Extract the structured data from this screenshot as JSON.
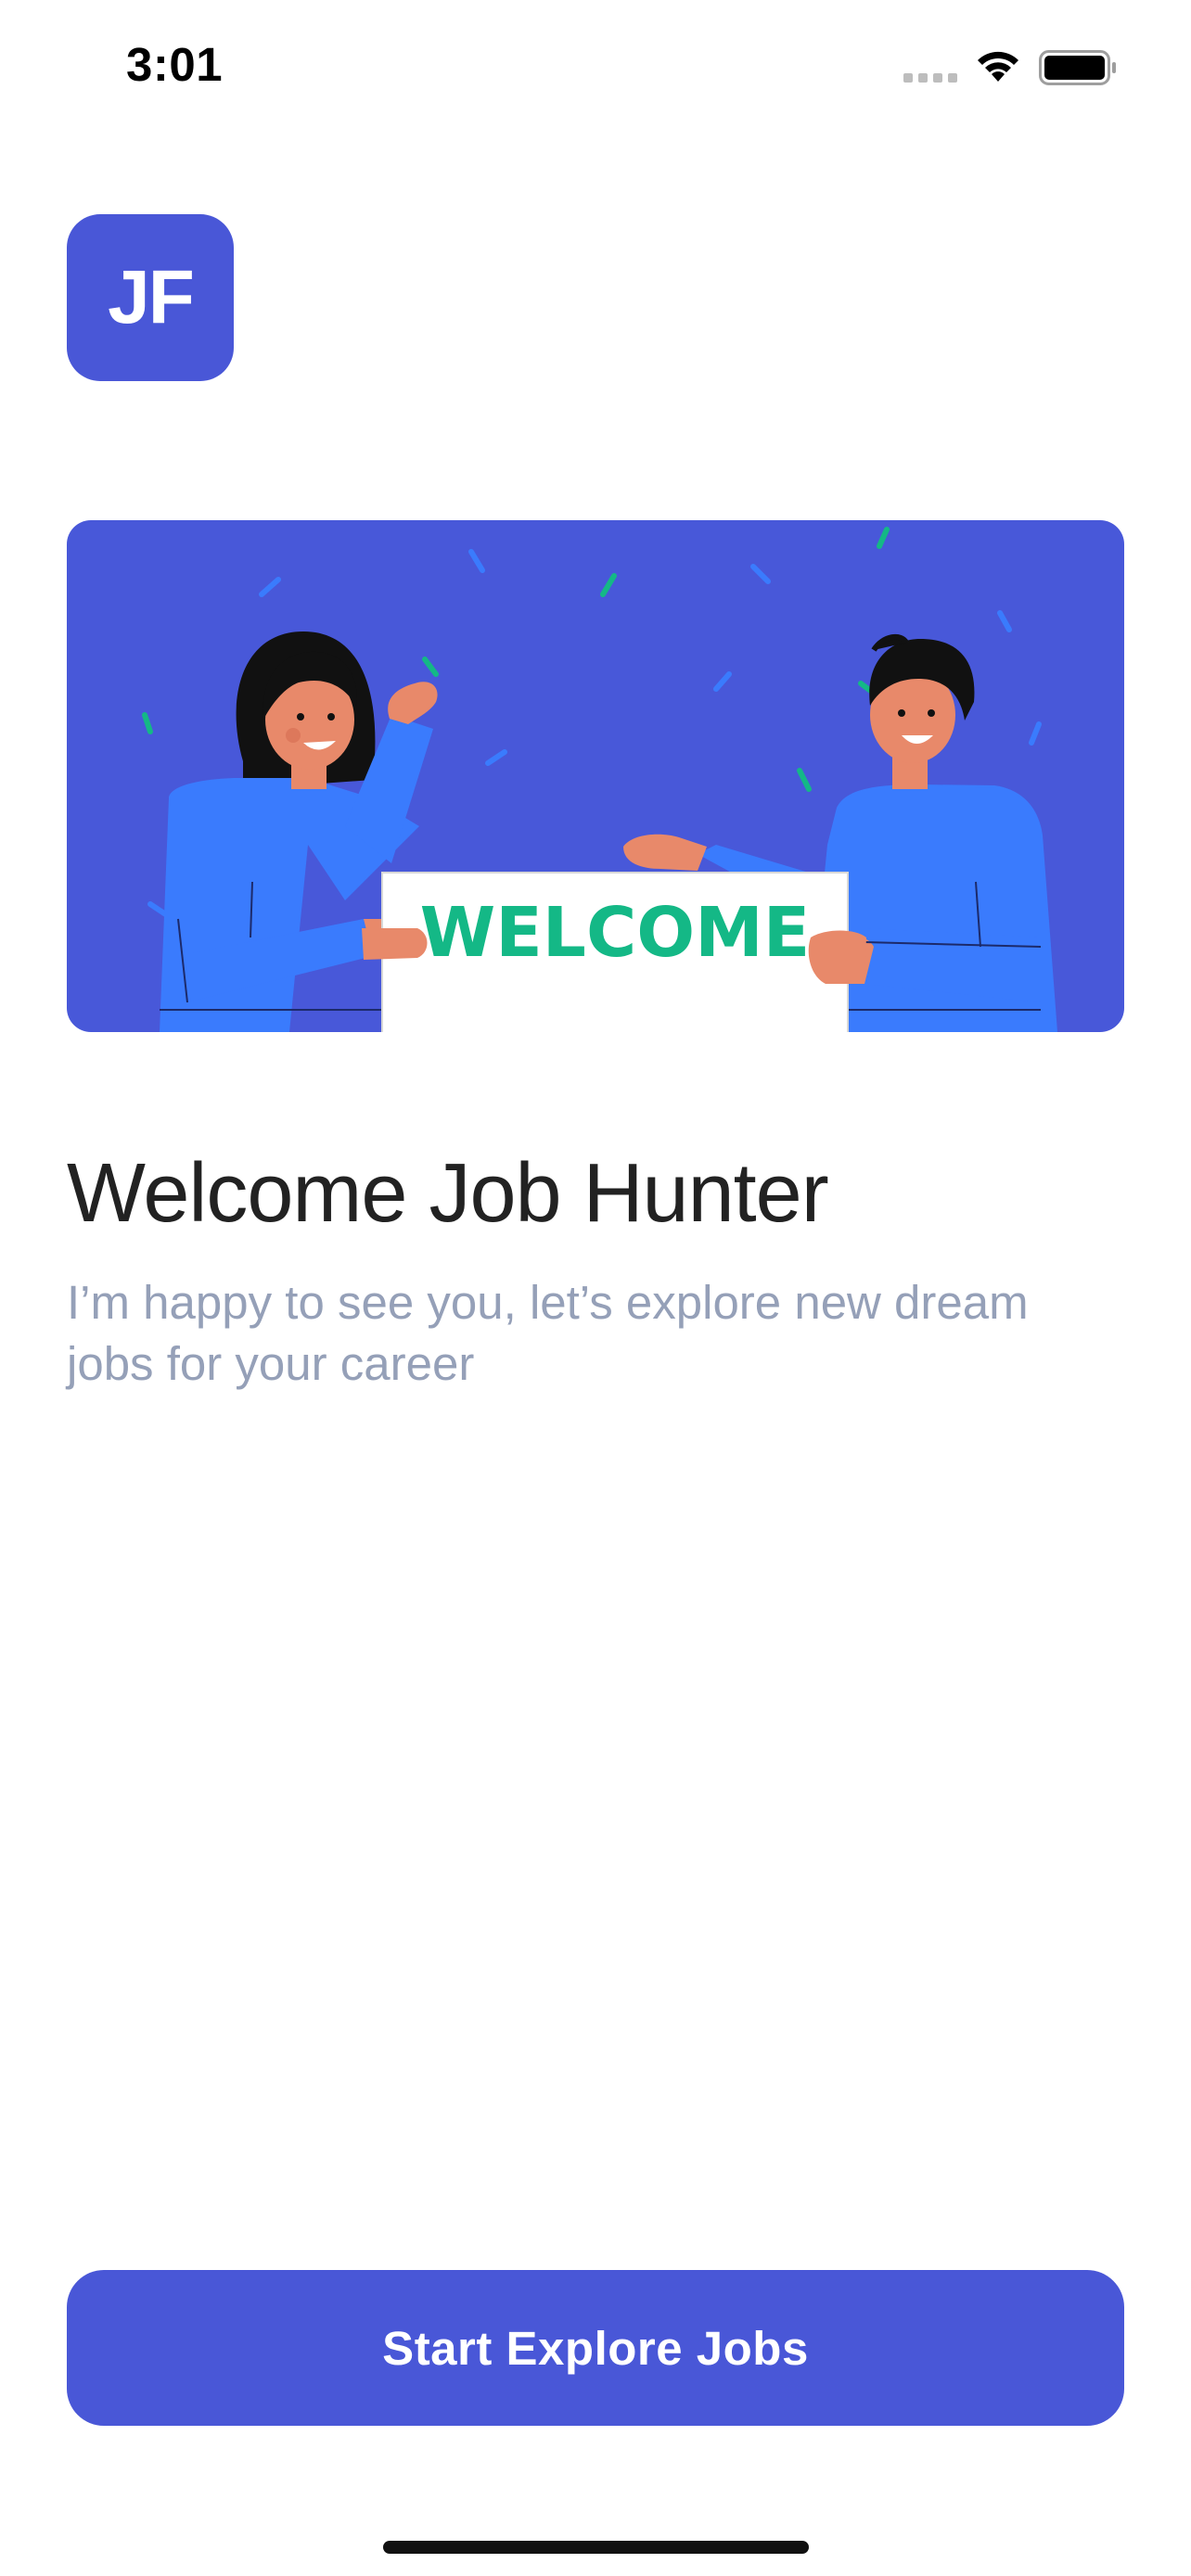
{
  "status_bar": {
    "time": "3:01",
    "icons": [
      "signal-dots-icon",
      "wifi-icon",
      "battery-icon"
    ]
  },
  "logo": {
    "text": "JF"
  },
  "hero": {
    "sign_text": "WELCOME",
    "colors": {
      "background": "#4858D9",
      "shirt": "#3A7BFD",
      "skin": "#E8896A",
      "sign_text": "#14B886"
    }
  },
  "welcome": {
    "title": "Welcome Job Hunter",
    "subtitle": "I’m happy to see you, let’s explore new dream jobs for your career"
  },
  "cta": {
    "label": "Start Explore Jobs"
  },
  "colors": {
    "primary": "#4957D7",
    "subtitle": "#95A0B8",
    "title": "#222222"
  }
}
